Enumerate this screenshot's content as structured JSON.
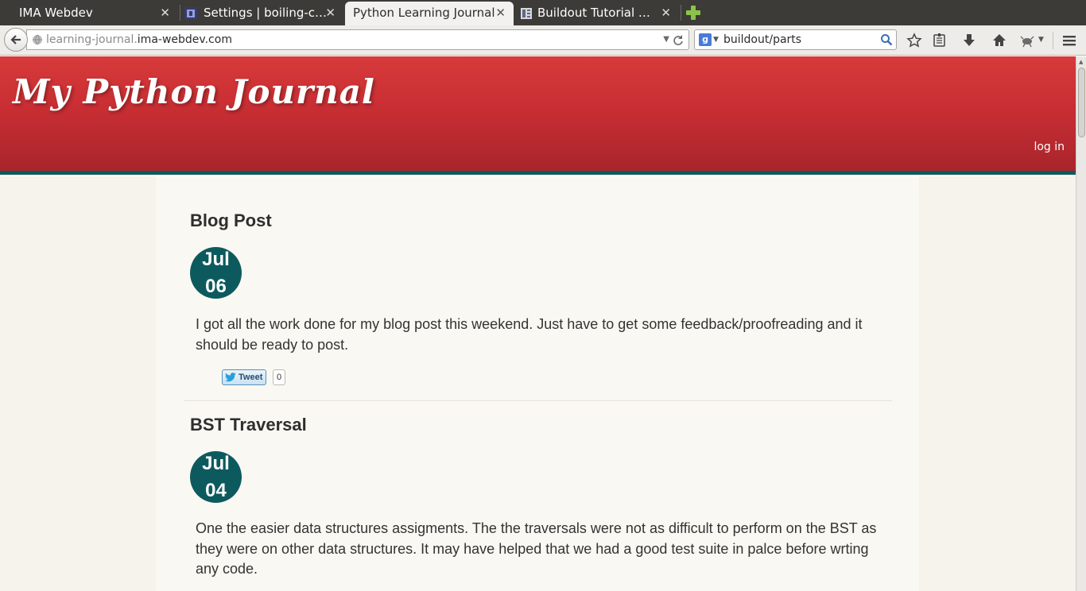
{
  "browser": {
    "tabs": [
      {
        "label": "IMA Webdev",
        "close": "✕"
      },
      {
        "label": "Settings | boiling-c…",
        "close": "✕"
      },
      {
        "label": "Python Learning Journal",
        "close": "✕"
      },
      {
        "label": "Buildout Tutorial …",
        "close": "✕"
      }
    ],
    "url_prefix": "learning-journal.",
    "url_domain": "ima-webdev.com",
    "search_value": "buildout/parts",
    "search_engine_letter": "g"
  },
  "site": {
    "title": "My Python Journal",
    "login_label": "log in"
  },
  "posts": [
    {
      "title": "Blog Post",
      "month": "Jul",
      "day": "06",
      "body": "I got all the work done for my blog post this weekend. Just have to get some feedback/proofreading and it should be ready to post.",
      "tweet_label": "Tweet",
      "tweet_count": "0"
    },
    {
      "title": "BST Traversal",
      "month": "Jul",
      "day": "04",
      "body": "One the easier data structures assigments. The the traversals were not as difficult to perform on the BST as they were on other data structures. It may have helped that we had a good test suite in palce before wrting any code."
    }
  ],
  "colors": {
    "header_red": "#c82e33",
    "accent_teal": "#0d5a5e",
    "page_bg": "#f6f3ec"
  },
  "icons": [
    "close-icon",
    "new-tab-icon",
    "back-arrow-icon",
    "globe-icon",
    "reload-icon",
    "search-icon",
    "bookmark-star-icon",
    "reading-list-icon",
    "download-icon",
    "home-icon",
    "extension-icon",
    "menu-icon",
    "twitter-bird-icon"
  ]
}
